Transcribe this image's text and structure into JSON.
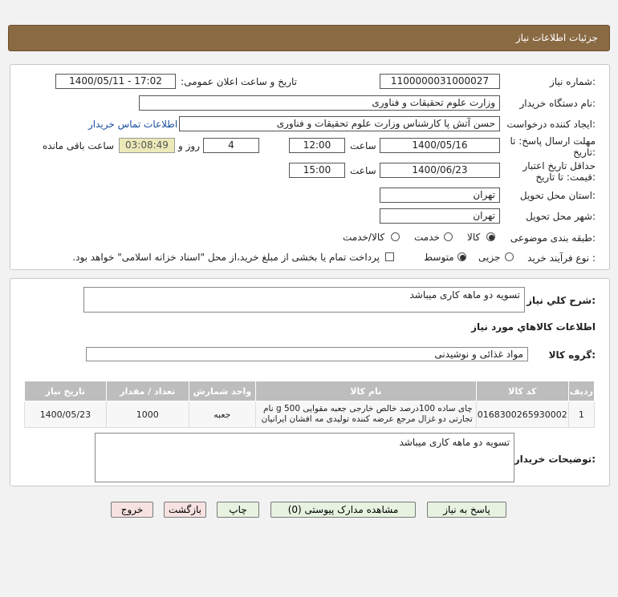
{
  "header": {
    "title": "جزئیات اطلاعات نیاز"
  },
  "form": {
    "need_number_label": "شماره نیاز:",
    "need_number": "1100000031000027",
    "announce_label": "تاریخ و ساعت اعلان عمومی:",
    "announce_value": "1400/05/11 - 17:02",
    "buyer_org_label": "نام دستگاه خریدار:",
    "buyer_org": "وزارت علوم  تحقیقات و فناوری",
    "creator_label": "ایجاد کننده درخواست:",
    "creator": "حسن آتش پا کارشناس وزارت علوم  تحقیقات و فناوری",
    "contact_link": "اطلاعات تماس خریدار",
    "deadline_label_1": "مهلت ارسال پاسخ: تا",
    "deadline_label_2": "تاریخ:",
    "deadline_date": "1400/05/16",
    "time_label": "ساعت",
    "deadline_time": "12:00",
    "days_value": "4",
    "days_label": "روز و",
    "remaining_value": "03:08:49",
    "remaining_label": "ساعت باقی مانده",
    "validity_label_1": "حداقل تاریخ اعتبار",
    "validity_label_2": "قیمت: تا تاریخ:",
    "validity_date": "1400/06/23",
    "validity_time_label": "ساعت",
    "validity_time": "15:00",
    "province_label": "استان محل تحویل:",
    "province": "تهران",
    "city_label": "شهر محل تحویل:",
    "city": "تهران",
    "category_label": "طبقه بندی موضوعی:",
    "category_options": [
      "کالا",
      "خدمت",
      "کالا/خدمت"
    ],
    "process_label": "نوع فرآیند خرید :",
    "process_options": [
      "جزیی",
      "متوسط"
    ],
    "payment_note": "پرداخت تمام یا بخشی از مبلغ خرید،از محل \"اسناد خزانه اسلامی\" خواهد بود."
  },
  "summary": {
    "label": "شرح کلي نياز:",
    "value": "تسویه دو ماهه کاری میباشد",
    "goods_info_title": "اطلاعات کالاهاي مورد نياز",
    "group_label": "گروه کالا:",
    "group_value": "مواد غذائی و نوشیدنی"
  },
  "table": {
    "headers": [
      "ردیف",
      "کد کالا",
      "نام کالا",
      "واحد شمارش",
      "تعداد / مقدار",
      "تاریخ نیاز"
    ],
    "rows": [
      {
        "row": "1",
        "code": "0168300265930002",
        "name_1": "چای ساده 100درصد خالص خارجی جعبه مقوایی 500 g نام",
        "name_2": "تجارتی دو غزال مرجع عرضه کننده تولیدی مه افشان ایرانیان",
        "unit": "جعبه",
        "qty": "1000",
        "date": "1400/05/23"
      }
    ]
  },
  "buyer_notes": {
    "label": "توضیحات خریدار:",
    "value": "تسویه دو ماهه کاری میباشد"
  },
  "buttons": {
    "reply": "پاسخ به نیاز",
    "attachments": "مشاهده مدارک پیوستی (0)",
    "print": "چاپ",
    "back": "بازگشت",
    "exit": "خروج"
  },
  "colors": {
    "header_bg": "#8a6a43",
    "button_green": "#e7f2e0",
    "button_pink": "#f7e1e1",
    "link": "#1a4fa0"
  }
}
